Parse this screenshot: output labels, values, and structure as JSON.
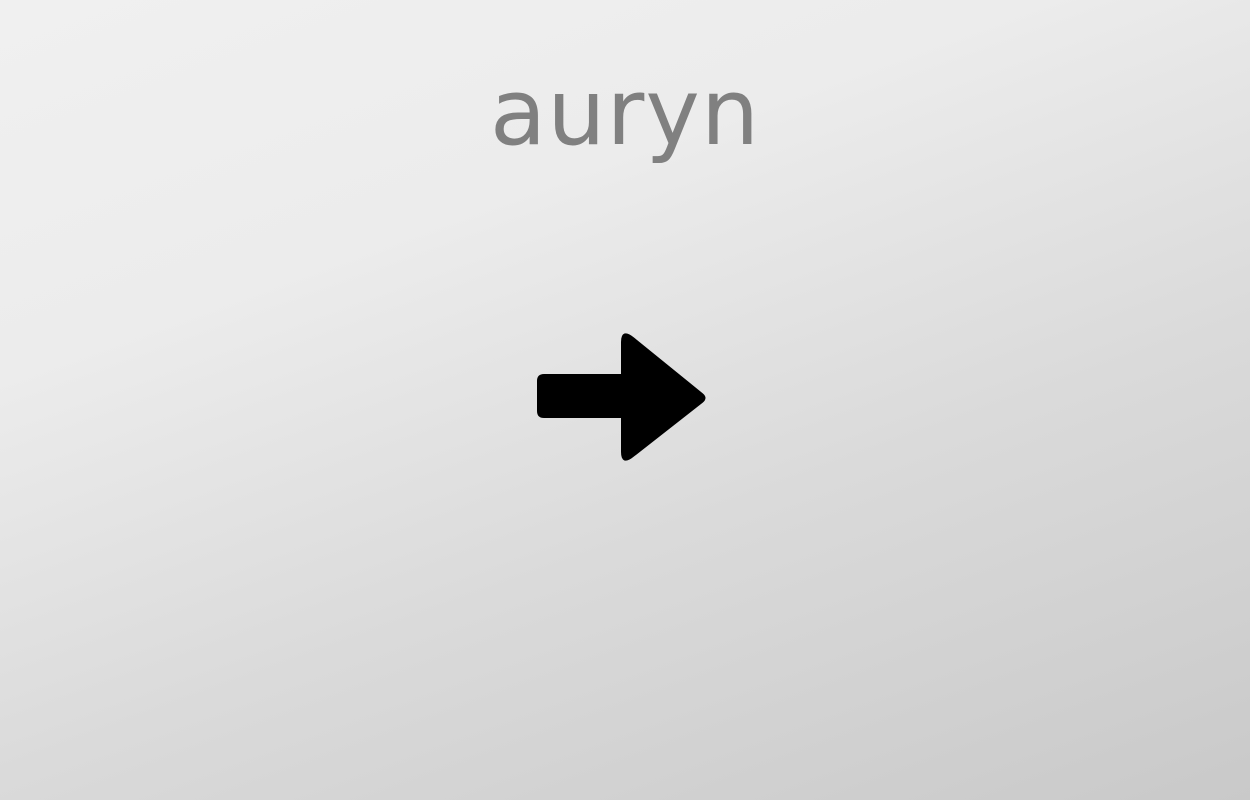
{
  "app": {
    "title": "auryn"
  },
  "actions": {
    "next_icon": "arrow-right-icon",
    "next_color": "#000000"
  },
  "theme": {
    "title_color": "#808080",
    "background_light": "#f0f0f0",
    "background_dark": "#c9c9c9"
  }
}
